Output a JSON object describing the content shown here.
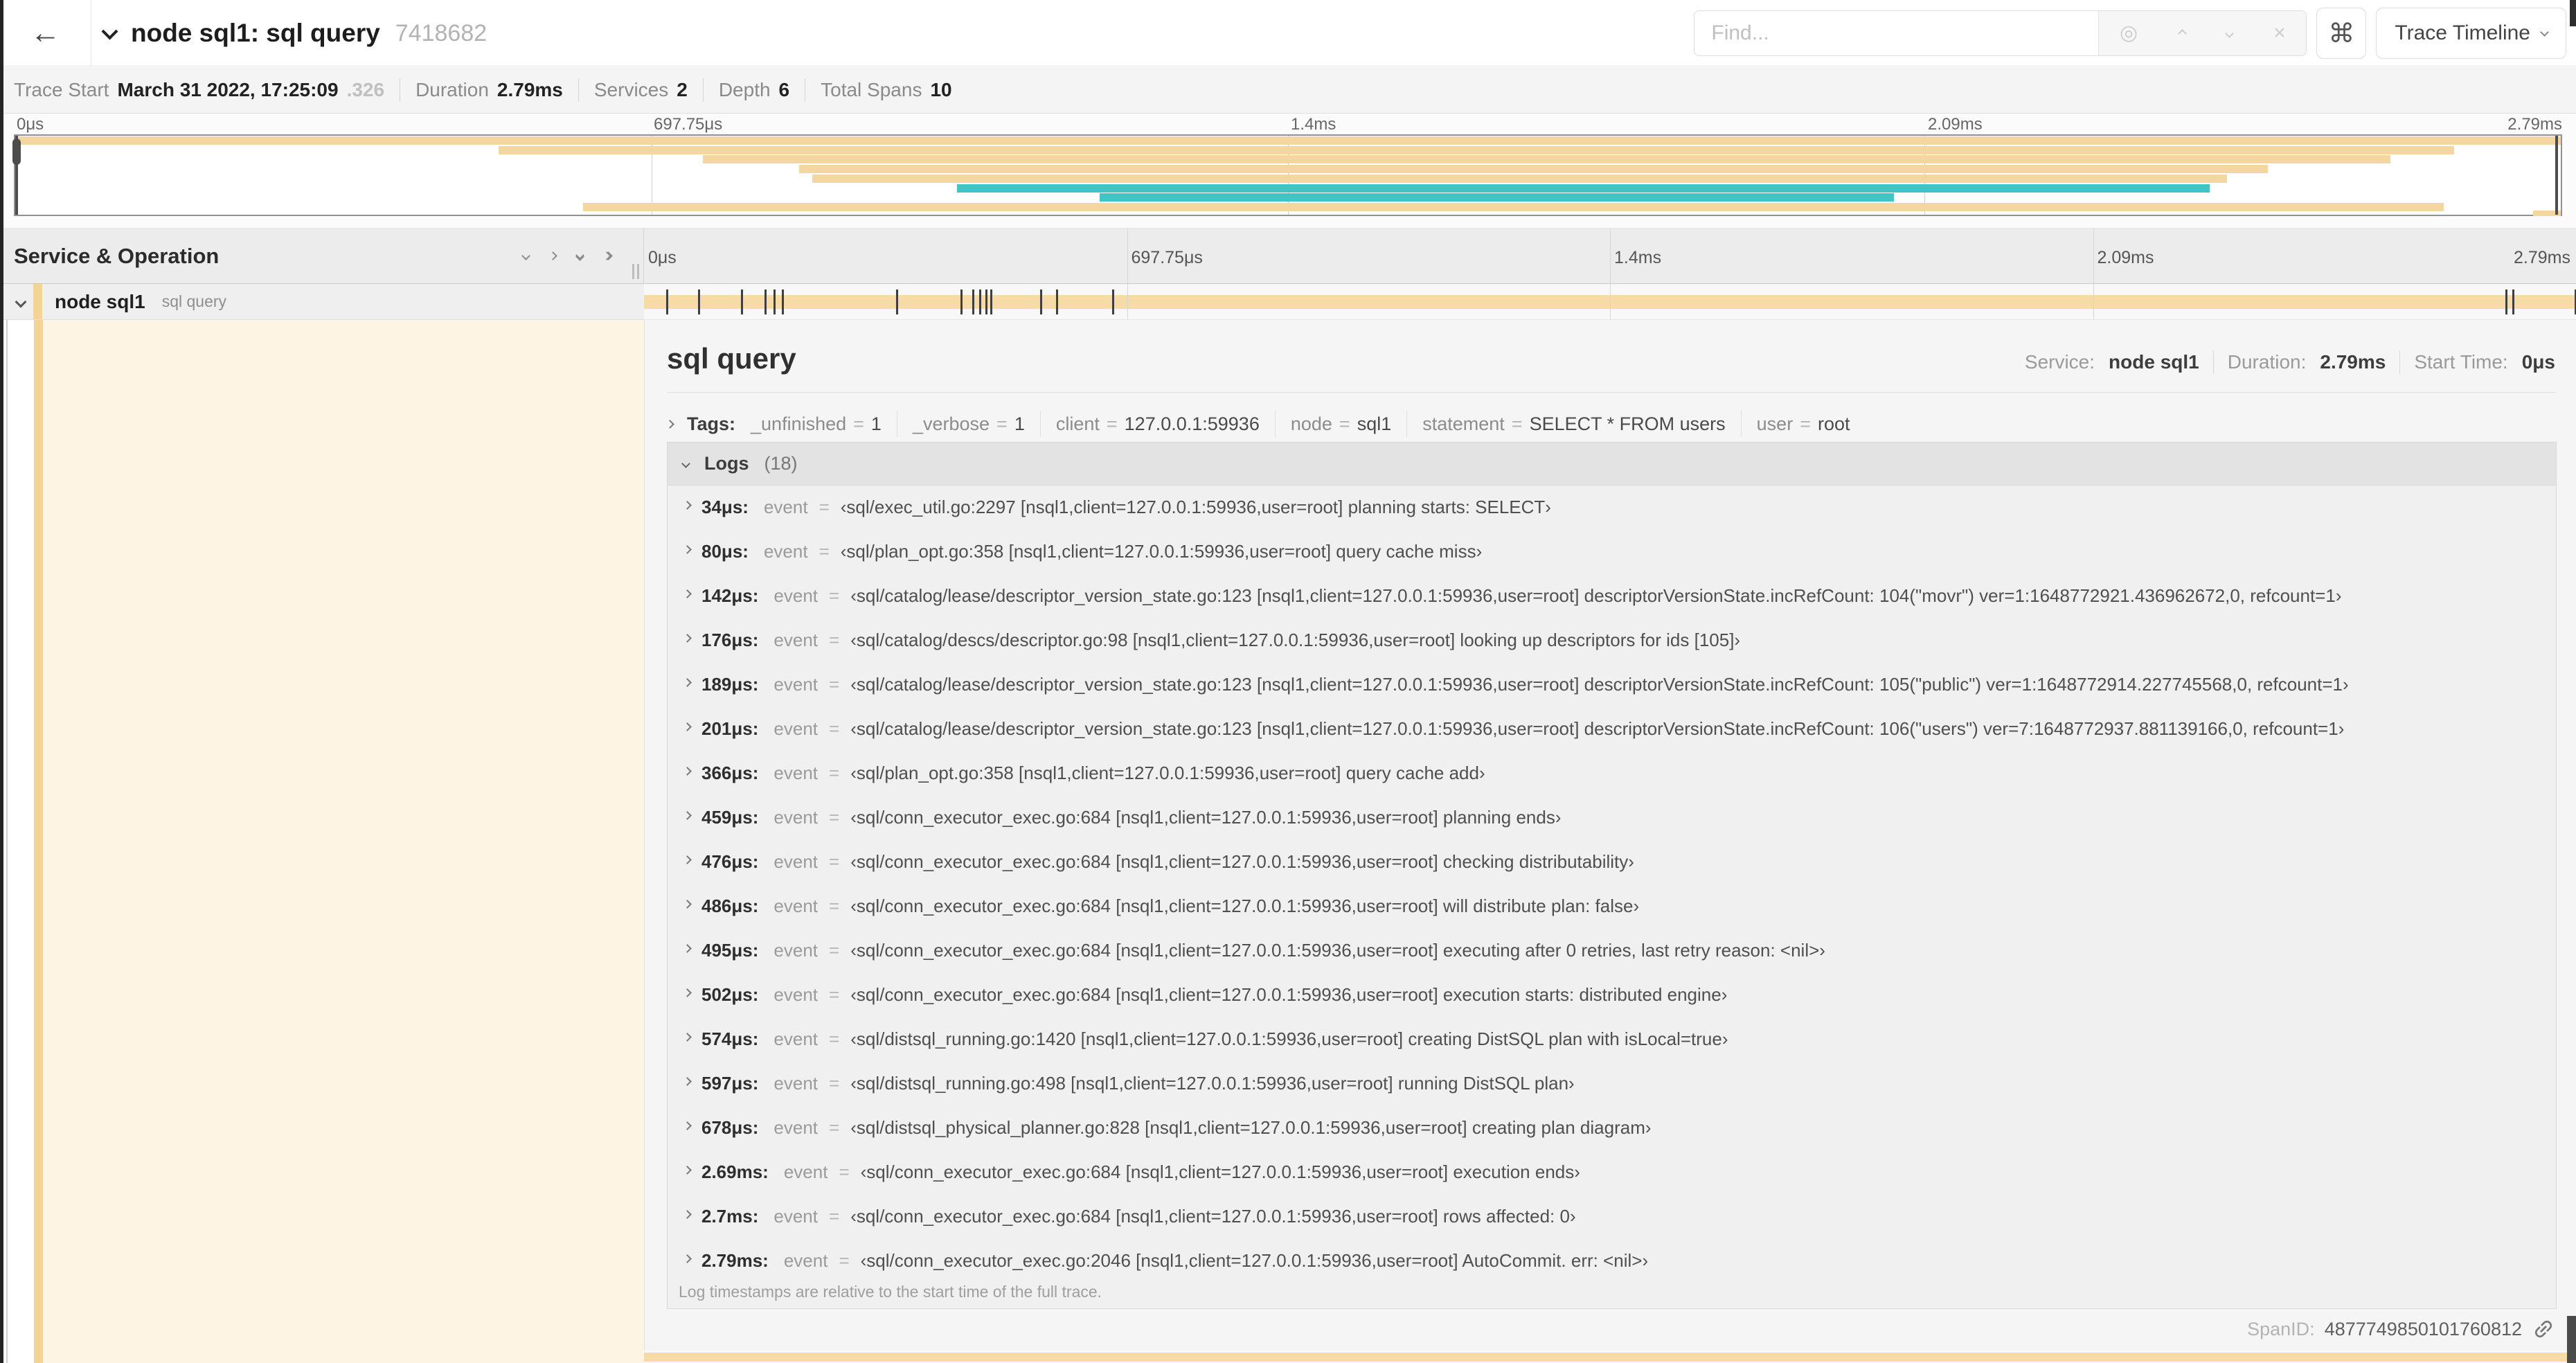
{
  "header": {
    "back_icon": "←",
    "title": "node sql1: sql query",
    "trace_id": "7418682",
    "find_placeholder": "Find...",
    "find_actions": [
      "locate-icon",
      "chevron-up-icon",
      "chevron-down-icon",
      "clear-icon"
    ],
    "keyboard_shortcut_icon": "⌘",
    "view_selector": "Trace Timeline"
  },
  "stats": [
    {
      "label": "Trace Start",
      "value": "March 31 2022, 17:25:09",
      "suffix": ".326"
    },
    {
      "label": "Duration",
      "value": "2.79ms"
    },
    {
      "label": "Services",
      "value": "2"
    },
    {
      "label": "Depth",
      "value": "6"
    },
    {
      "label": "Total Spans",
      "value": "10"
    }
  ],
  "timeline": {
    "total_us": 2790,
    "ruler_ticks": [
      "0μs",
      "697.75μs",
      "1.4ms",
      "2.09ms",
      "2.79ms"
    ],
    "minimap_spans": [
      {
        "row": 0,
        "start": 0,
        "end": 100,
        "color": "tan"
      },
      {
        "row": 1,
        "start": 19,
        "end": 95.8,
        "color": "tan"
      },
      {
        "row": 2,
        "start": 27,
        "end": 93.3,
        "color": "tan"
      },
      {
        "row": 3,
        "start": 30.8,
        "end": 88.5,
        "color": "tan"
      },
      {
        "row": 4,
        "start": 31.3,
        "end": 86.9,
        "color": "tan"
      },
      {
        "row": 5,
        "start": 37,
        "end": 86.2,
        "color": "teal"
      },
      {
        "row": 6,
        "start": 42.6,
        "end": 73.8,
        "color": "teal"
      },
      {
        "row": 7,
        "start": 22.3,
        "end": 95.4,
        "color": "tan"
      },
      {
        "row": 7.8,
        "start": 98.9,
        "end": 100,
        "color": "tan",
        "h": 8
      }
    ]
  },
  "span_tree": {
    "header": "Service & Operation",
    "rows": [
      {
        "service": "node sql1",
        "operation": "sql query"
      }
    ]
  },
  "span_detail": {
    "title": "sql query",
    "meta": [
      {
        "label": "Service:",
        "value": "node sql1"
      },
      {
        "label": "Duration:",
        "value": "2.79ms"
      },
      {
        "label": "Start Time:",
        "value": "0μs"
      }
    ],
    "tags_label": "Tags:",
    "tags": [
      {
        "key": "_unfinished",
        "value": "1"
      },
      {
        "key": "_verbose",
        "value": "1"
      },
      {
        "key": "client",
        "value": "127.0.0.1:59936"
      },
      {
        "key": "node",
        "value": "sql1"
      },
      {
        "key": "statement",
        "value": "SELECT * FROM users"
      },
      {
        "key": "user",
        "value": "root"
      }
    ],
    "logs_label": "Logs",
    "logs_count": "(18)",
    "logs": [
      {
        "time": "34μs:",
        "time_us": 34,
        "field": "event",
        "value": "‹sql/exec_util.go:2297 [nsql1,client=127.0.0.1:59936,user=root] planning starts: SELECT›"
      },
      {
        "time": "80μs:",
        "time_us": 80,
        "field": "event",
        "value": "‹sql/plan_opt.go:358 [nsql1,client=127.0.0.1:59936,user=root] query cache miss›"
      },
      {
        "time": "142μs:",
        "time_us": 142,
        "field": "event",
        "value": "‹sql/catalog/lease/descriptor_version_state.go:123 [nsql1,client=127.0.0.1:59936,user=root] descriptorVersionState.incRefCount: 104(\"movr\") ver=1:1648772921.436962672,0, refcount=1›"
      },
      {
        "time": "176μs:",
        "time_us": 176,
        "field": "event",
        "value": "‹sql/catalog/descs/descriptor.go:98 [nsql1,client=127.0.0.1:59936,user=root] looking up descriptors for ids [105]›"
      },
      {
        "time": "189μs:",
        "time_us": 189,
        "field": "event",
        "value": "‹sql/catalog/lease/descriptor_version_state.go:123 [nsql1,client=127.0.0.1:59936,user=root] descriptorVersionState.incRefCount: 105(\"public\") ver=1:1648772914.227745568,0, refcount=1›"
      },
      {
        "time": "201μs:",
        "time_us": 201,
        "field": "event",
        "value": "‹sql/catalog/lease/descriptor_version_state.go:123 [nsql1,client=127.0.0.1:59936,user=root] descriptorVersionState.incRefCount: 106(\"users\") ver=7:1648772937.881139166,0, refcount=1›"
      },
      {
        "time": "366μs:",
        "time_us": 366,
        "field": "event",
        "value": "‹sql/plan_opt.go:358 [nsql1,client=127.0.0.1:59936,user=root] query cache add›"
      },
      {
        "time": "459μs:",
        "time_us": 459,
        "field": "event",
        "value": "‹sql/conn_executor_exec.go:684 [nsql1,client=127.0.0.1:59936,user=root] planning ends›"
      },
      {
        "time": "476μs:",
        "time_us": 476,
        "field": "event",
        "value": "‹sql/conn_executor_exec.go:684 [nsql1,client=127.0.0.1:59936,user=root] checking distributability›"
      },
      {
        "time": "486μs:",
        "time_us": 486,
        "field": "event",
        "value": "‹sql/conn_executor_exec.go:684 [nsql1,client=127.0.0.1:59936,user=root] will distribute plan: false›"
      },
      {
        "time": "495μs:",
        "time_us": 495,
        "field": "event",
        "value": "‹sql/conn_executor_exec.go:684 [nsql1,client=127.0.0.1:59936,user=root] executing after 0 retries, last retry reason: <nil>›"
      },
      {
        "time": "502μs:",
        "time_us": 502,
        "field": "event",
        "value": "‹sql/conn_executor_exec.go:684 [nsql1,client=127.0.0.1:59936,user=root] execution starts: distributed engine›"
      },
      {
        "time": "574μs:",
        "time_us": 574,
        "field": "event",
        "value": "‹sql/distsql_running.go:1420 [nsql1,client=127.0.0.1:59936,user=root] creating DistSQL plan with isLocal=true›"
      },
      {
        "time": "597μs:",
        "time_us": 597,
        "field": "event",
        "value": "‹sql/distsql_running.go:498 [nsql1,client=127.0.0.1:59936,user=root] running DistSQL plan›"
      },
      {
        "time": "678μs:",
        "time_us": 678,
        "field": "event",
        "value": "‹sql/distsql_physical_planner.go:828 [nsql1,client=127.0.0.1:59936,user=root] creating plan diagram›"
      },
      {
        "time": "2.69ms:",
        "time_us": 2690,
        "field": "event",
        "value": "‹sql/conn_executor_exec.go:684 [nsql1,client=127.0.0.1:59936,user=root] execution ends›"
      },
      {
        "time": "2.7ms:",
        "time_us": 2700,
        "field": "event",
        "value": "‹sql/conn_executor_exec.go:684 [nsql1,client=127.0.0.1:59936,user=root] rows affected: 0›"
      },
      {
        "time": "2.79ms:",
        "time_us": 2790,
        "field": "event",
        "value": "‹sql/conn_executor_exec.go:2046 [nsql1,client=127.0.0.1:59936,user=root] AutoCommit. err: <nil>›"
      }
    ],
    "logs_note": "Log timestamps are relative to the start time of the full trace.",
    "span_id_label": "SpanID:",
    "span_id": "4877749850101760812"
  },
  "colors": {
    "accent_tan": "#f4d7a0",
    "bar_tan": "#f6dba6",
    "accent_teal": "#41c4c6",
    "selected_strip": "#f3d496",
    "cream": "#fdf4e3"
  }
}
